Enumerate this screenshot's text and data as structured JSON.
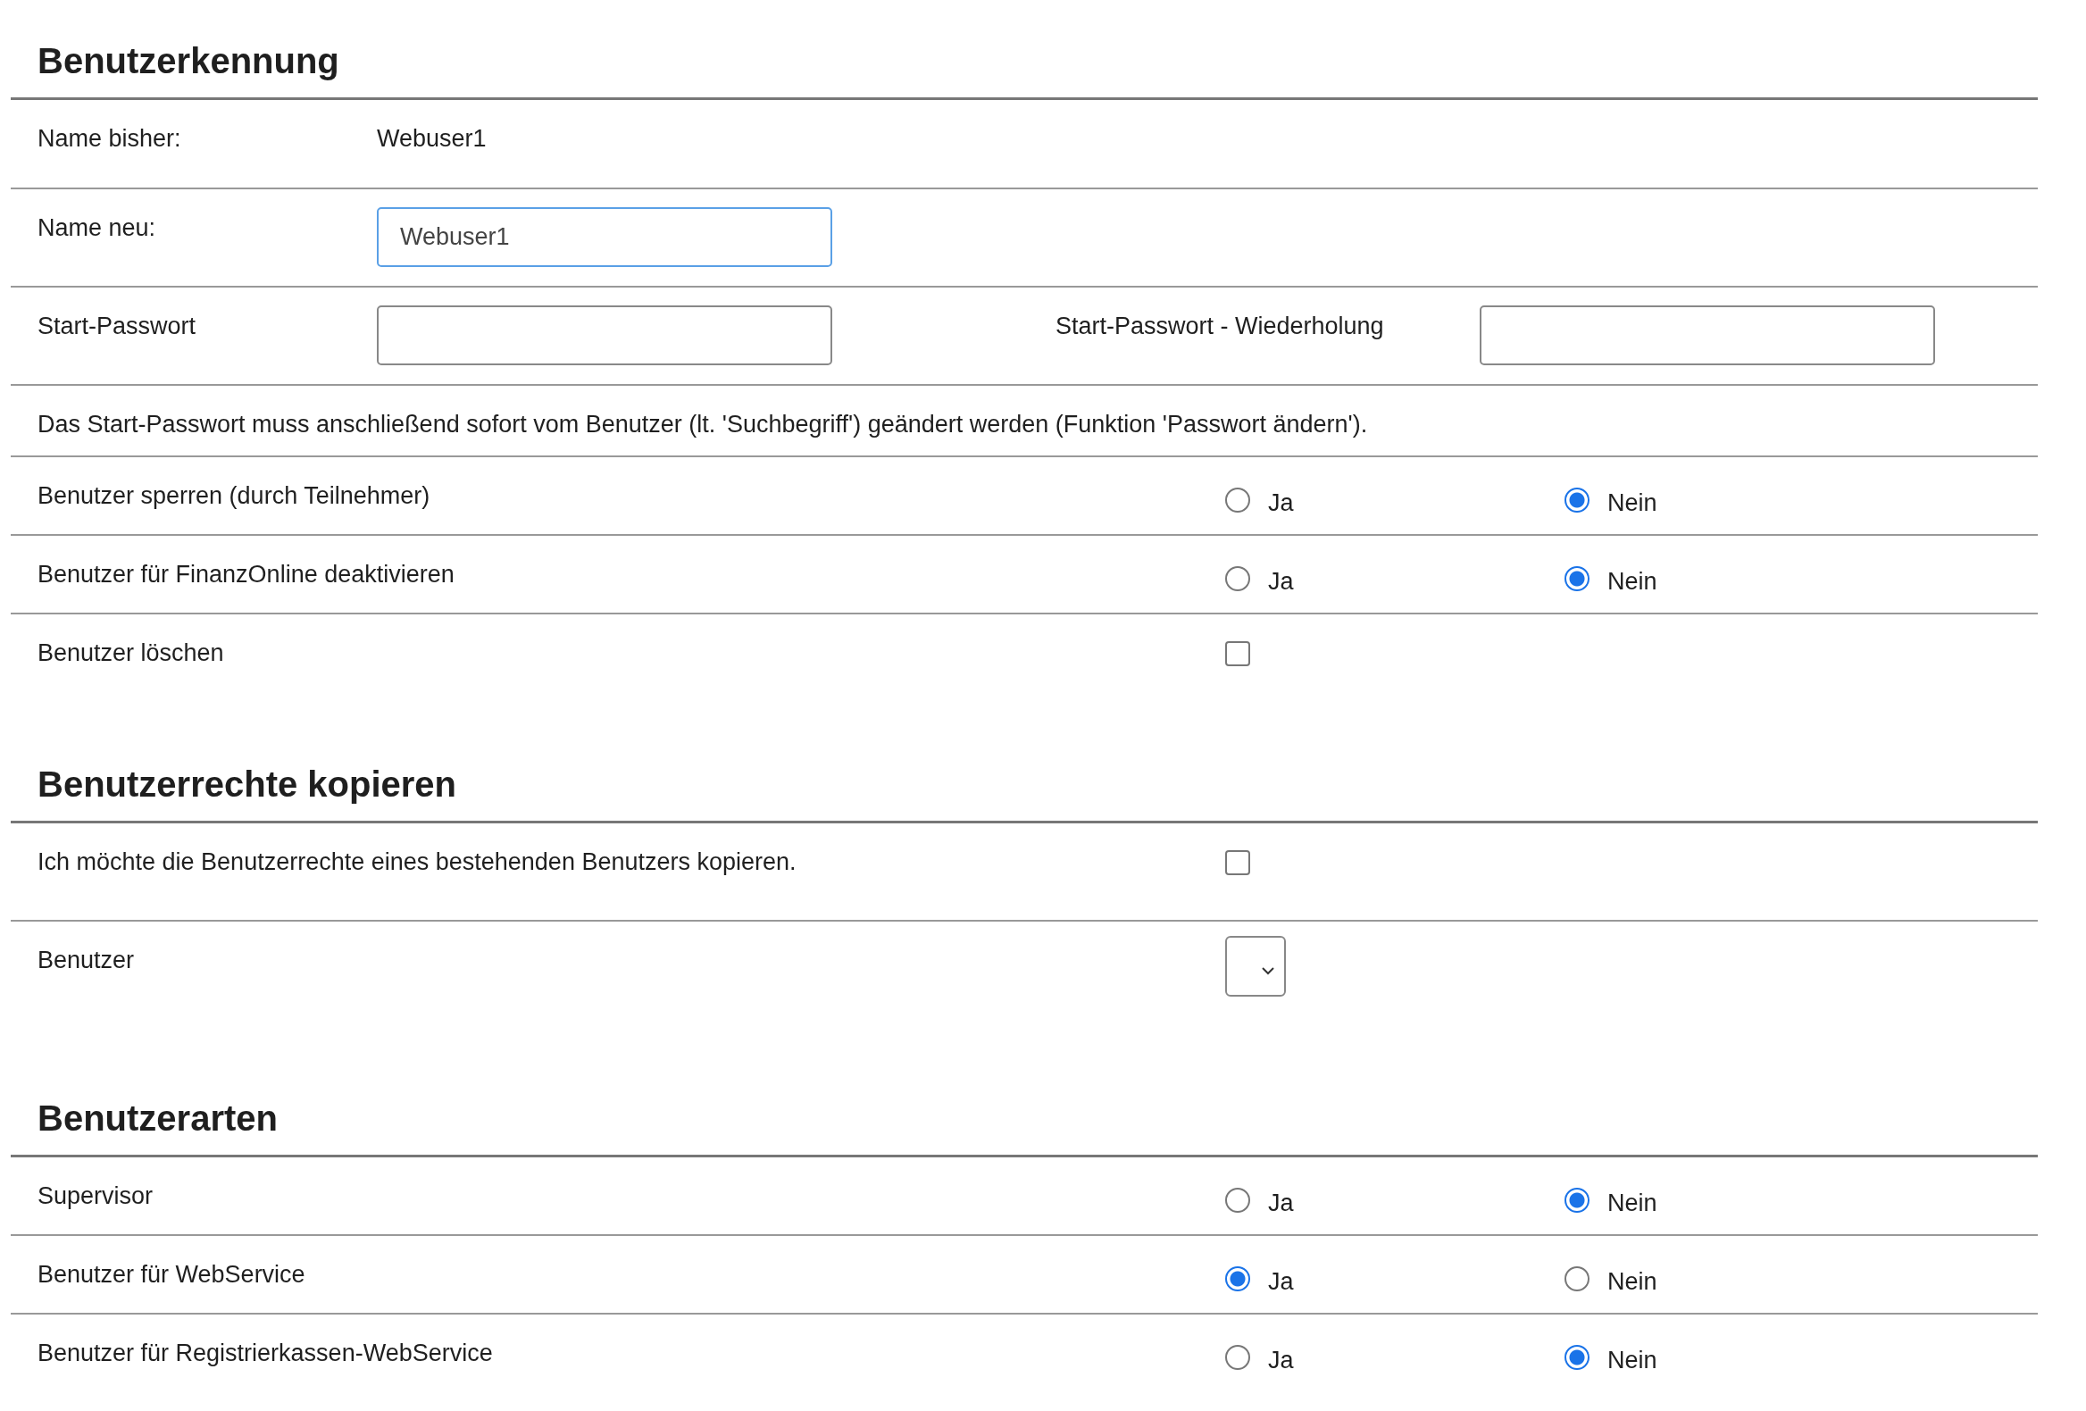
{
  "sections": [
    {
      "title": "Benutzerkennung",
      "rows": [
        {
          "kind": "text",
          "label": "Name bisher:",
          "value": "Webuser1"
        },
        {
          "kind": "input",
          "label": "Name neu:",
          "value": "Webuser1",
          "focused": true
        },
        {
          "kind": "password_pair",
          "label": "Start-Passwort",
          "second_label": "Start-Passwort - Wiederholung"
        },
        {
          "kind": "note",
          "label": "Das Start-Passwort muss anschließend sofort vom Benutzer (lt. 'Suchbegriff') geändert werden (Funktion 'Passwort ändern')."
        },
        {
          "kind": "radio",
          "label": "Benutzer sperren (durch Teilnehmer)",
          "options": [
            {
              "label": "Ja",
              "selected": false
            },
            {
              "label": "Nein",
              "selected": true
            }
          ]
        },
        {
          "kind": "radio",
          "label": "Benutzer für FinanzOnline deaktivieren",
          "options": [
            {
              "label": "Ja",
              "selected": false
            },
            {
              "label": "Nein",
              "selected": true
            }
          ]
        },
        {
          "kind": "checkbox",
          "label": "Benutzer löschen",
          "checked": false
        }
      ]
    },
    {
      "title": "Benutzerrechte kopieren",
      "rows": [
        {
          "kind": "checkbox",
          "label": "Ich möchte die Benutzerrechte eines bestehenden Benutzers kopieren.",
          "checked": false
        },
        {
          "kind": "select",
          "label": "Benutzer"
        }
      ]
    },
    {
      "title": "Benutzerarten",
      "rows": [
        {
          "kind": "radio",
          "label": "Supervisor",
          "options": [
            {
              "label": "Ja",
              "selected": false
            },
            {
              "label": "Nein",
              "selected": true
            }
          ]
        },
        {
          "kind": "radio",
          "label": "Benutzer für WebService",
          "options": [
            {
              "label": "Ja",
              "selected": true
            },
            {
              "label": "Nein",
              "selected": false
            }
          ]
        },
        {
          "kind": "radio",
          "label": "Benutzer für Registrierkassen-WebService",
          "options": [
            {
              "label": "Ja",
              "selected": false
            },
            {
              "label": "Nein",
              "selected": true
            }
          ]
        }
      ]
    }
  ]
}
